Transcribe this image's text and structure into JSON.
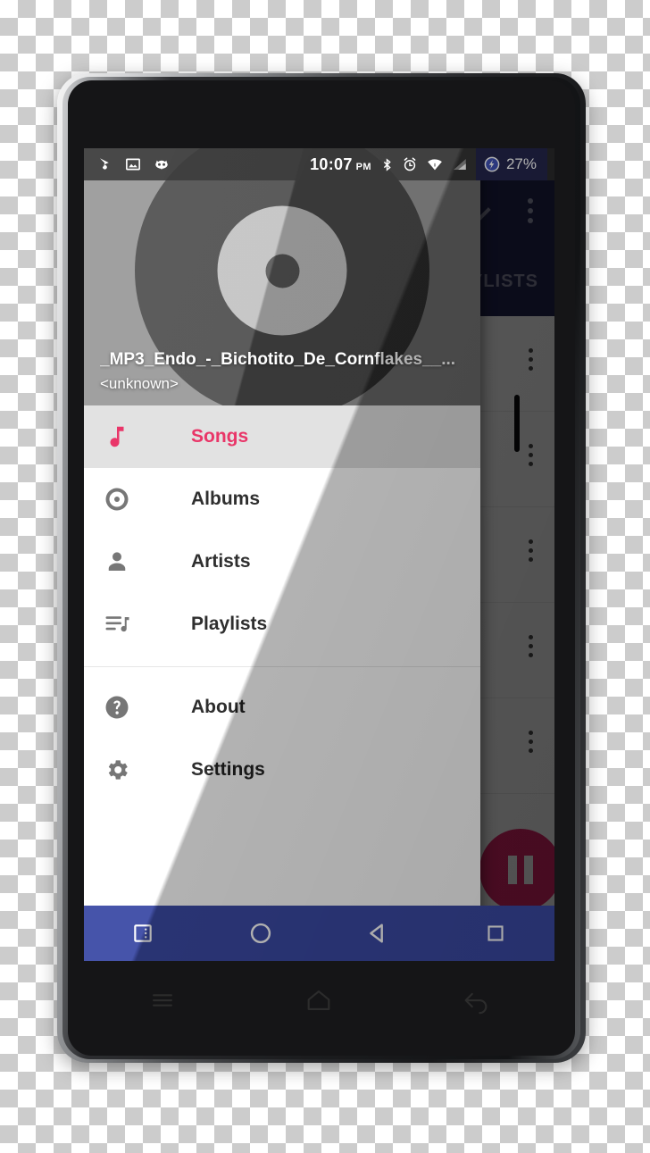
{
  "device": {
    "hardware": {
      "front_camera": "front-camera",
      "proximity_sensor": "proximity-sensor",
      "earpiece_speaker": "earpiece-speaker",
      "power_button": "power-button",
      "volume_button": "volume-button"
    },
    "capacitive_keys": [
      {
        "name": "menu-key",
        "icon": "hamburger-icon"
      },
      {
        "name": "home-key",
        "icon": "home-outline-icon"
      },
      {
        "name": "back-key",
        "icon": "back-arrow-icon"
      }
    ]
  },
  "status_bar": {
    "left_icons": [
      "location-pin-icon",
      "image-icon",
      "cyanogenmod-icon"
    ],
    "time": "10:07",
    "am_pm": "PM",
    "right_icons": [
      "bluetooth-icon",
      "alarm-icon",
      "wifi-icon",
      "signal-icon"
    ],
    "battery_icon": "battery-charging-icon",
    "battery_level": "27%",
    "battery_bg_color": "#24264C"
  },
  "background_app": {
    "app_bar_color": "#232451",
    "tab_label": "AYLISTS",
    "overflow_menu": "overflow-menu-icon",
    "caret_icon": "chevron-icon",
    "rows": [
      {
        "overflow": "overflow-menu-icon"
      },
      {
        "overflow": "overflow-menu-icon"
      },
      {
        "overflow": "overflow-menu-icon"
      },
      {
        "overflow": "overflow-menu-icon"
      },
      {
        "overflow": "overflow-menu-icon"
      }
    ],
    "fab": {
      "icon": "pause-icon",
      "color": "#E0246A"
    }
  },
  "drawer": {
    "header": {
      "artwork": "vinyl-record-artwork",
      "title": "_MP3_Endo_-_Bichotito_De_Cornflakes__...",
      "subtitle": "<unknown>",
      "background_color": "#8E8E8E"
    },
    "accent_color": "#E8295F",
    "selected_row_color": "#E0E0E0",
    "items": [
      {
        "label": "Songs",
        "icon": "music-note-icon",
        "selected": true
      },
      {
        "label": "Albums",
        "icon": "album-disc-icon",
        "selected": false
      },
      {
        "label": "Artists",
        "icon": "person-icon",
        "selected": false
      },
      {
        "label": "Playlists",
        "icon": "playlist-icon",
        "selected": false
      }
    ],
    "secondary_items": [
      {
        "label": "About",
        "icon": "help-circle-icon",
        "selected": false
      },
      {
        "label": "Settings",
        "icon": "gear-icon",
        "selected": false
      }
    ]
  },
  "navigation_bar": {
    "color": "#3B4AA5",
    "buttons": [
      {
        "name": "menu-button",
        "icon": "menu-box-icon"
      },
      {
        "name": "home-button",
        "icon": "circle-icon"
      },
      {
        "name": "back-button",
        "icon": "triangle-back-icon"
      },
      {
        "name": "recents-button",
        "icon": "square-icon"
      }
    ]
  }
}
